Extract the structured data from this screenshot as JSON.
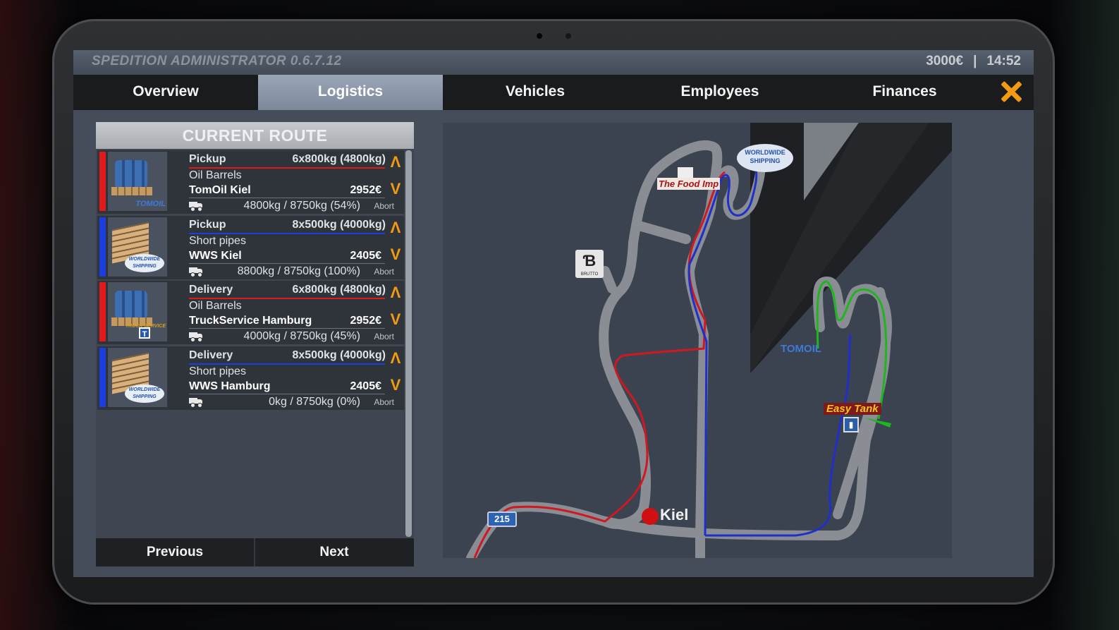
{
  "app": {
    "title": "SPEDITION ADMINISTRATOR 0.6.7.12",
    "money": "3000€",
    "separator": "|",
    "time": "14:52"
  },
  "tabs": [
    {
      "label": "Overview",
      "active": false
    },
    {
      "label": "Logistics",
      "active": true
    },
    {
      "label": "Vehicles",
      "active": false
    },
    {
      "label": "Employees",
      "active": false
    },
    {
      "label": "Finances",
      "active": false
    }
  ],
  "route": {
    "header": "CURRENT ROUTE",
    "items": [
      {
        "type": "Pickup",
        "qty": "6x800kg (4800kg)",
        "cargo": "Oil Barrels",
        "place": "TomOil Kiel",
        "price": "2952€",
        "load": "4800kg / 8750kg (54%)",
        "abort": "Abort",
        "color": "#e01a1a",
        "thumb": "barrels",
        "logo": "TOMOIL"
      },
      {
        "type": "Pickup",
        "qty": "8x500kg (4000kg)",
        "cargo": "Short pipes",
        "place": "WWS Kiel",
        "price": "2405€",
        "load": "8800kg / 8750kg (100%)",
        "abort": "Abort",
        "color": "#1a3ee0",
        "thumb": "pipes",
        "logo": "WORLDWIDE SHIPPING"
      },
      {
        "type": "Delivery",
        "qty": "6x800kg (4800kg)",
        "cargo": "Oil Barrels",
        "place": "TruckService Hamburg",
        "price": "2952€",
        "load": "4000kg / 8750kg (45%)",
        "abort": "Abort",
        "color": "#e01a1a",
        "thumb": "barrels",
        "logo": "TRUCK SERVICE"
      },
      {
        "type": "Delivery",
        "qty": "8x500kg (4000kg)",
        "cargo": "Short pipes",
        "place": "WWS Hamburg",
        "price": "2405€",
        "load": "0kg / 8750kg (0%)",
        "abort": "Abort",
        "color": "#1a3ee0",
        "thumb": "pipes",
        "logo": "WORLDWIDE SHIPPING"
      }
    ],
    "move_up_glyph": "Λ",
    "move_down_glyph": "V",
    "prev_label": "Previous",
    "next_label": "Next"
  },
  "map": {
    "city_label": "Kiel",
    "road_number": "215",
    "food_label": "The Food Imp",
    "ws_logo": "WORLDWIDE SHIPPING",
    "brutto_logo": "BRUTTO",
    "tomoil_label": "TOMOIL",
    "easytank_label": "Easy Tank",
    "colors": {
      "route_red": "#d01820",
      "route_blue": "#1f2fc8",
      "route_green": "#1fb51f",
      "road": "#8a8e94"
    }
  }
}
